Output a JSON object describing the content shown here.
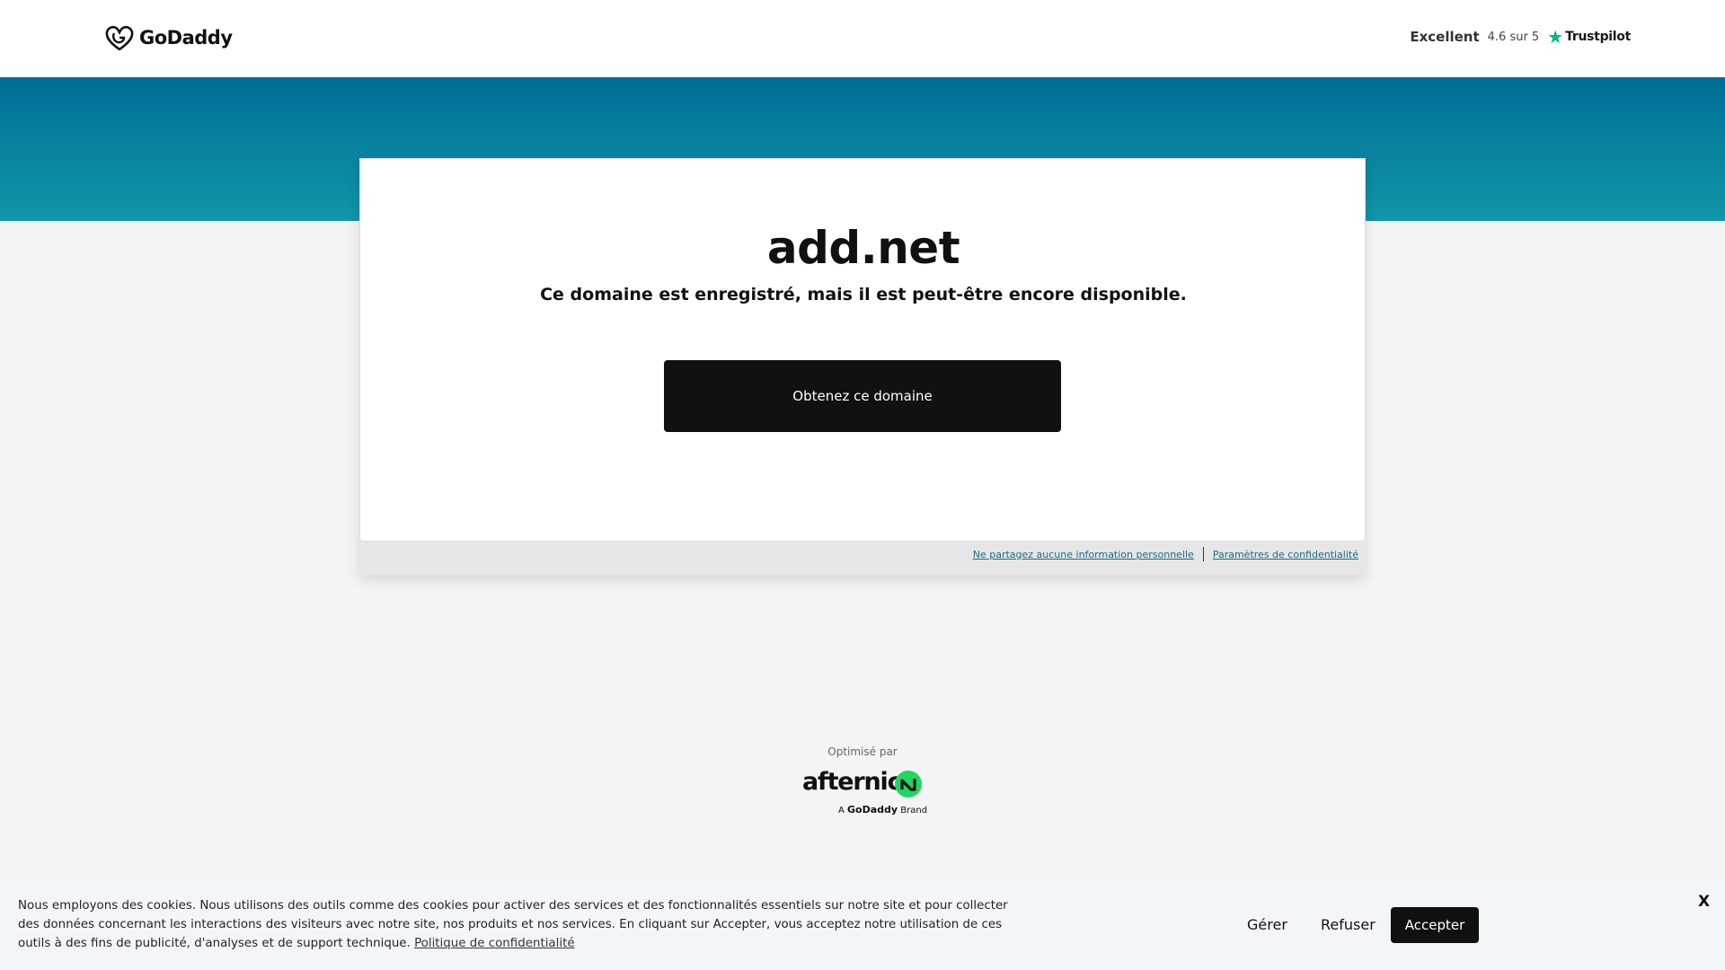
{
  "header": {
    "logo_text": "GoDaddy",
    "trustpilot": {
      "label": "Excellent",
      "rating": "4.6 sur 5",
      "brand": "Trustpilot",
      "star_color": "#00b67a"
    }
  },
  "main": {
    "domain": "add.net",
    "subtitle": "Ce domaine est enregistré, mais il est peut-être encore disponible.",
    "cta_label": "Obtenez ce domaine"
  },
  "footer_links": {
    "no_share": "Ne partagez aucune information personnelle",
    "privacy_settings": "Paramètres de confidentialité"
  },
  "powered_by": {
    "label": "Optimisé par",
    "brand": "afternic",
    "sub_prefix": "A",
    "sub_brand": "GoDaddy",
    "sub_suffix": "Brand",
    "accent_color": "#1ed760"
  },
  "cookie_banner": {
    "text": "Nous employons des cookies. Nous utilisons des outils comme des cookies pour activer des services et des fonctionnalités essentiels sur notre site et pour collecter des données concernant les interactions des visiteurs avec notre site, nos produits et nos services. En cliquant sur Accepter, vous acceptez notre utilisation de ces outils à des fins de publicité, d'analyses et de support technique.",
    "policy_link": "Politique de confidentialité",
    "manage": "Gérer",
    "refuse": "Refuser",
    "accept": "Accepter",
    "close": "X"
  },
  "colors": {
    "banner_top": "#006e96",
    "banner_bottom": "#1296a8",
    "button": "#111111"
  }
}
